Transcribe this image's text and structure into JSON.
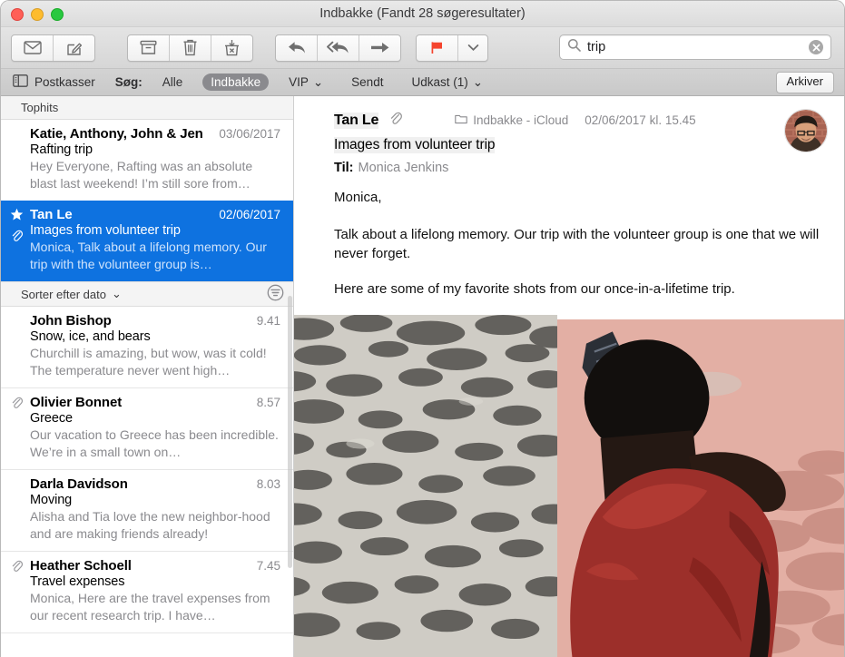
{
  "window": {
    "title": "Indbakke (Fandt 28 søgeresultater)",
    "traffic_lights": [
      "close",
      "minimize",
      "zoom"
    ]
  },
  "toolbar": {
    "buttons": [
      {
        "name": "get-mail-button",
        "icon": "envelope-icon",
        "label": "Hent nye beskeder"
      },
      {
        "name": "compose-button",
        "icon": "compose-icon",
        "label": "Ny besked"
      },
      {
        "name": "archive-button",
        "icon": "archive-box-icon",
        "label": "Arkiver"
      },
      {
        "name": "delete-button",
        "icon": "trash-icon",
        "label": "Slet"
      },
      {
        "name": "junk-button",
        "icon": "junk-icon",
        "label": "Uønsket"
      },
      {
        "name": "reply-button",
        "icon": "reply-arrow-icon",
        "label": "Svar"
      },
      {
        "name": "reply-all-button",
        "icon": "reply-all-arrow-icon",
        "label": "Svar alle"
      },
      {
        "name": "forward-button",
        "icon": "forward-arrow-icon",
        "label": "Videresend"
      },
      {
        "name": "flag-button",
        "icon": "flag-icon",
        "label": "Flag"
      },
      {
        "name": "flag-menu-button",
        "icon": "chevron-down-icon",
        "label": "Flagmenu"
      }
    ],
    "flag_color": "#f5442e"
  },
  "search": {
    "value": "trip",
    "placeholder": "Søg",
    "icon": "search-icon",
    "clear_icon": "clear-circle-icon"
  },
  "favorites_bar": {
    "mailboxes_label": "Postkasser",
    "mailboxes_icon": "sidebar-icon",
    "search_label": "Søg:",
    "scopes": [
      {
        "label": "Alle",
        "active": false,
        "has_menu": false
      },
      {
        "label": "Indbakke",
        "active": true,
        "has_menu": false
      },
      {
        "label": "VIP",
        "active": false,
        "has_menu": true
      },
      {
        "label": "Sendt",
        "active": false,
        "has_menu": false
      },
      {
        "label": "Udkast (1)",
        "active": false,
        "has_menu": true
      }
    ],
    "archive_button": "Arkiver",
    "chevron": "⌄"
  },
  "message_list": {
    "tophits_header": "Tophits",
    "sort_label": "Sorter efter dato",
    "sort_chevron": "⌄",
    "filter_icon": "filter-icon",
    "tophits": [
      {
        "sender": "Katie, Anthony, John & Jen",
        "date": "03/06/2017",
        "subject": "Rafting trip",
        "snippet": "Hey Everyone, Rafting was an absolute blast last weekend! I’m still sore from…",
        "selected": false,
        "flagged": false,
        "has_attachment": false
      },
      {
        "sender": "Tan Le",
        "date": "02/06/2017",
        "subject": "Images from volunteer trip",
        "snippet": "Monica, Talk about a lifelong memory. Our trip with the volunteer group is…",
        "selected": true,
        "flagged": true,
        "has_attachment": true
      }
    ],
    "messages": [
      {
        "sender": "John Bishop",
        "date": "9.41",
        "subject": "Snow, ice, and bears",
        "snippet": "Churchill is amazing, but wow, was it cold! The temperature never went high…",
        "selected": false,
        "flagged": false,
        "has_attachment": false
      },
      {
        "sender": "Olivier Bonnet",
        "date": "8.57",
        "subject": "Greece",
        "snippet": "Our vacation to Greece has been incredible. We’re in a small town on…",
        "selected": false,
        "flagged": false,
        "has_attachment": true
      },
      {
        "sender": "Darla Davidson",
        "date": "8.03",
        "subject": "Moving",
        "snippet": "Alisha and Tia love the new neighbor-hood and are making friends already!",
        "selected": false,
        "flagged": false,
        "has_attachment": false
      },
      {
        "sender": "Heather Schoell",
        "date": "7.45",
        "subject": "Travel expenses",
        "snippet": "Monica, Here are the travel expenses from our recent research trip. I have…",
        "selected": false,
        "flagged": false,
        "has_attachment": true
      }
    ]
  },
  "reading_pane": {
    "from": "Tan Le",
    "attachment_icon": "paperclip-icon",
    "mailbox_icon": "folder-icon",
    "mailbox": "Indbakke - iCloud",
    "timestamp": "02/06/2017 kl. 15.45",
    "subject": "Images from volunteer trip",
    "to_label": "Til:",
    "to_value": "Monica Jenkins",
    "avatar_name": "avatar",
    "body": [
      "Monica,",
      "Talk about a lifelong memory. Our trip with the volunteer group is one that we will never forget.",
      "Here are some of my favorite shots from our once-in-a-lifetime trip."
    ],
    "attachments": [
      {
        "name": "photo-attachment-left",
        "description": "Dappled shadows on gray pavement"
      },
      {
        "name": "photo-attachment-right",
        "description": "Person in red shirt seated on pink pavement"
      }
    ]
  },
  "colors": {
    "selection_blue": "#0e72e0",
    "flag_red": "#f5442e",
    "muted_text": "#8a8a8e",
    "toolbar_gray": "#dcdcdc",
    "favbar_gray": "#cdcdcd"
  }
}
